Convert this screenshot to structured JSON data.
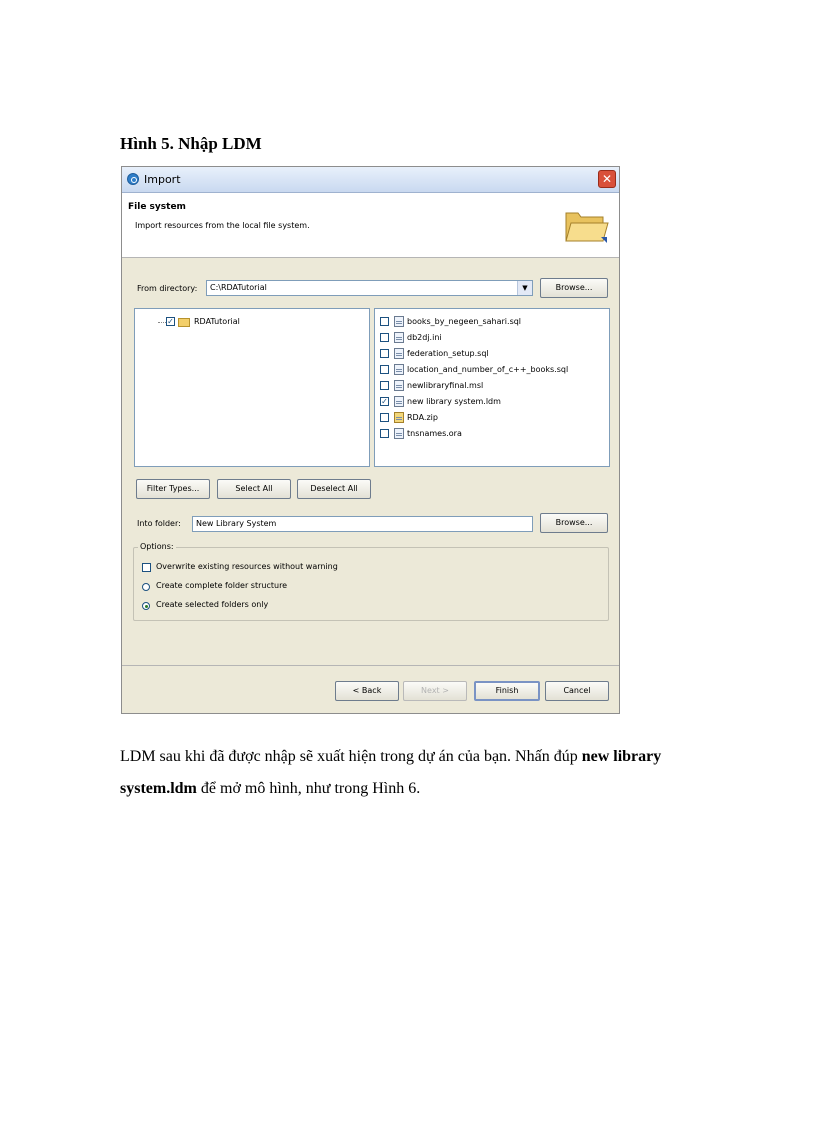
{
  "caption": "Hình 5. Nhập LDM",
  "paragraph": {
    "part1": "LDM sau khi đã được nhập sẽ xuất hiện trong dự án của bạn. Nhấn đúp ",
    "bold1": "new library system.ldm",
    "part2": " để mở mô hình, như trong Hình 6."
  },
  "dialog": {
    "title": "Import",
    "close_glyph": "✕",
    "banner": {
      "heading": "File system",
      "description": "Import resources from the local file system."
    },
    "from_directory": {
      "label": "From directory:",
      "value": "C:\\RDATutorial",
      "browse_label": "Browse..."
    },
    "tree": {
      "root_label": "RDATutorial",
      "root_checked": true
    },
    "files": [
      {
        "name": "books_by_negeen_sahari.sql",
        "checked": false
      },
      {
        "name": "db2dj.ini",
        "checked": false
      },
      {
        "name": "federation_setup.sql",
        "checked": false
      },
      {
        "name": "location_and_number_of_c++_books.sql",
        "checked": false
      },
      {
        "name": "newlibraryfinal.msl",
        "checked": false
      },
      {
        "name": "new library system.ldm",
        "checked": true
      },
      {
        "name": "RDA.zip",
        "checked": false
      },
      {
        "name": "tnsnames.ora",
        "checked": false
      }
    ],
    "buttons": {
      "filter_types": "Filter Types...",
      "select_all": "Select All",
      "deselect_all": "Deselect All"
    },
    "into_folder": {
      "label": "Into folder:",
      "value": "New Library System",
      "browse_label": "Browse..."
    },
    "options": {
      "legend": "Options:",
      "overwrite": "Overwrite existing resources without warning",
      "create_complete": "Create complete folder structure",
      "create_selected": "Create selected folders only",
      "selected_option": "create_selected"
    },
    "footer": {
      "back": "< Back",
      "next": "Next >",
      "finish": "Finish",
      "cancel": "Cancel"
    }
  }
}
